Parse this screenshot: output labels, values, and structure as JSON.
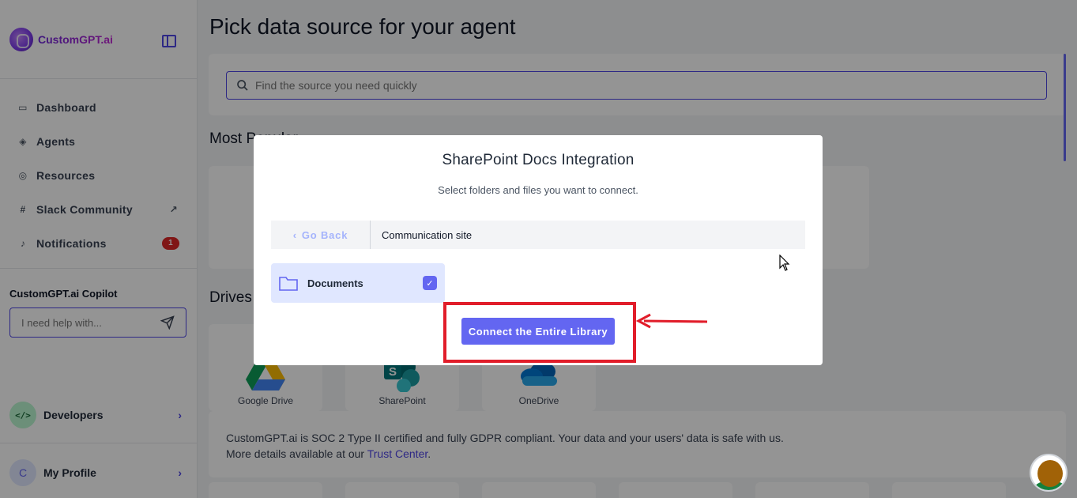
{
  "sidebar": {
    "brand": "CustomGPT.ai",
    "nav": [
      {
        "label": "Dashboard"
      },
      {
        "label": "Agents"
      },
      {
        "label": "Resources"
      },
      {
        "label": "Slack Community"
      },
      {
        "label": "Notifications",
        "badge": "1"
      }
    ],
    "copilot_title": "CustomGPT.ai Copilot",
    "copilot_placeholder": "I need help with...",
    "developers": "Developers",
    "profile_initial": "C",
    "profile": "My Profile"
  },
  "main": {
    "title": "Pick data source for your agent",
    "search_placeholder": "Find the source you need quickly",
    "section_popular": "Most Popular",
    "section_drives": "Drives",
    "drives": [
      {
        "label": "Google Drive"
      },
      {
        "label": "SharePoint"
      },
      {
        "label": "OneDrive"
      }
    ],
    "footer_line1": "CustomGPT.ai is SOC 2 Type II certified and fully GDPR compliant. Your data and your users' data is safe with us.",
    "footer_line2_prefix": "More details available at our ",
    "footer_link": "Trust Center",
    "footer_line2_suffix": "."
  },
  "modal": {
    "title": "SharePoint Docs Integration",
    "subtitle": "Select folders and files you want to connect.",
    "go_back": "Go Back",
    "breadcrumb": "Communication site",
    "folder": "Documents",
    "connect_button": "Connect the Entire Library"
  },
  "colors": {
    "accent": "#6366f1",
    "highlight": "#e11d2a"
  }
}
